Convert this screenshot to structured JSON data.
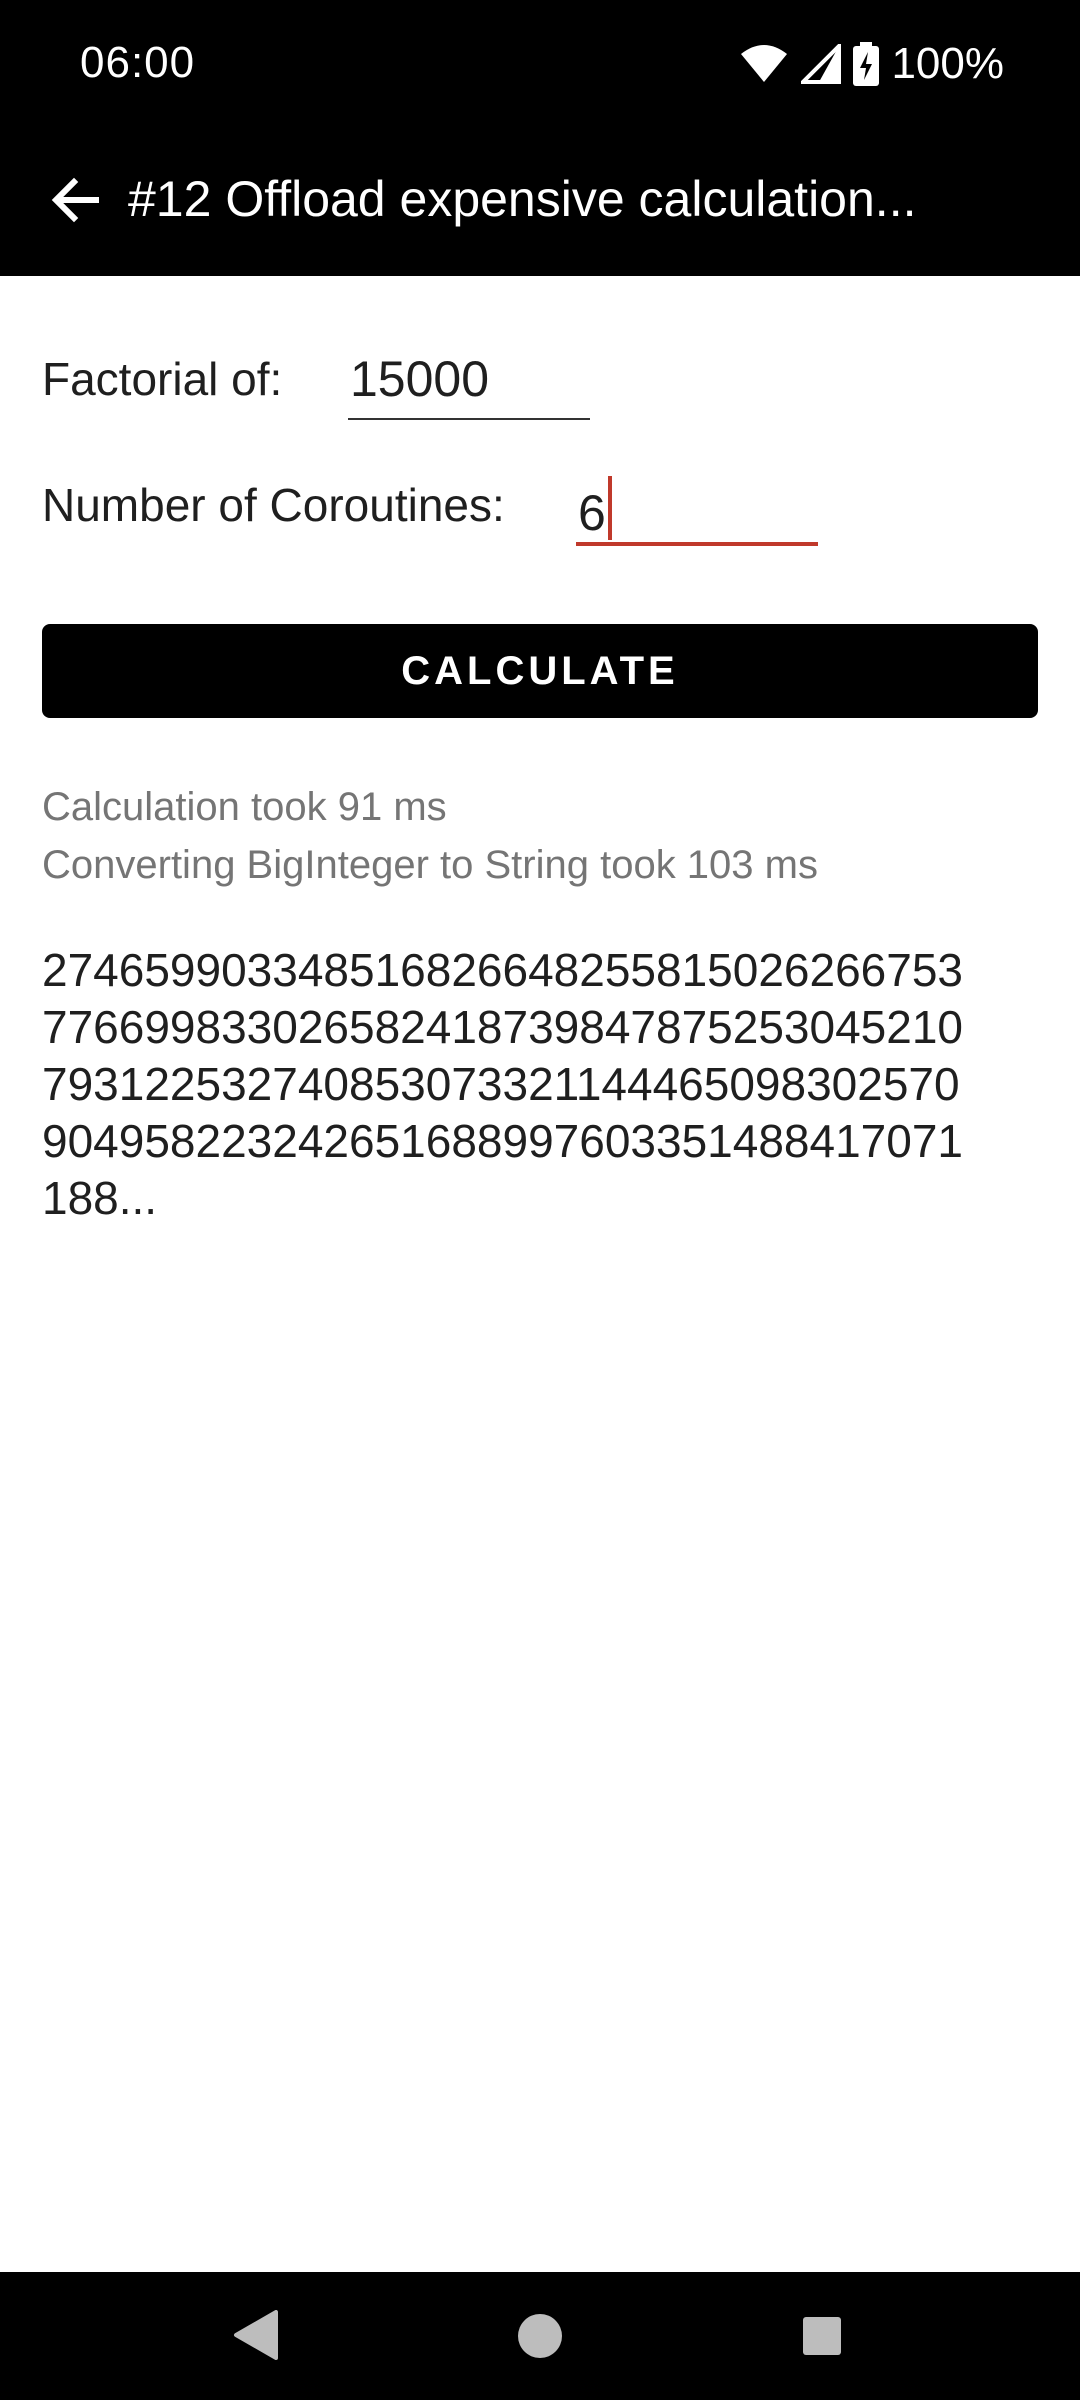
{
  "status_bar": {
    "time": "06:00",
    "battery_percent": "100%",
    "icons": [
      "wifi-icon",
      "cell-signal-icon",
      "battery-charging-icon"
    ]
  },
  "toolbar": {
    "title": "#12 Offload expensive calculation...",
    "back_icon": "arrow-back-icon"
  },
  "form": {
    "factorial_label": "Factorial of:",
    "factorial_value": "15000",
    "coroutines_label": "Number of Coroutines:",
    "coroutines_value": "6",
    "calculate_label": "CALCULATE"
  },
  "results": {
    "calc_time": "Calculation took 91 ms",
    "convert_time": "Converting BigInteger to String took 103 ms",
    "result_lines": [
      "2746599033485168266482558150262667 53",
      "7766998330265824187398478752530452 10",
      "7931225327408530733211444650983025 70",
      "9049582232426516889976033514884170 71",
      "188..."
    ]
  },
  "nav_bar": {
    "icons": [
      "nav-back-icon",
      "nav-home-icon",
      "nav-recents-icon"
    ]
  }
}
